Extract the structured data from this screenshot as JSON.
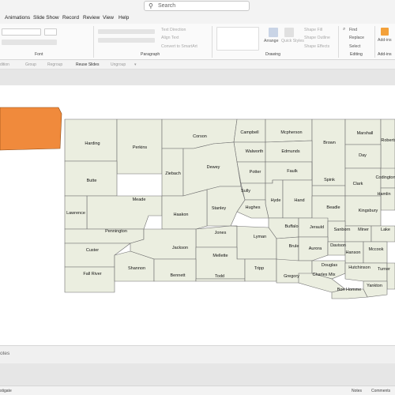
{
  "search": {
    "placeholder": "Search"
  },
  "tabs": [
    "Animations",
    "Slide Show",
    "Record",
    "Review",
    "View",
    "Help"
  ],
  "ribbon": {
    "font_group": "Font",
    "paragraph_group": "Paragraph",
    "drawing_group": "Drawing",
    "editing_group": "Editing",
    "addins_group": "Add-ins",
    "text_direction": "Text Direction",
    "align_text": "Align Text",
    "convert_smartart": "Convert to SmartArt",
    "arrange": "Arrange",
    "quick_styles": "Quick Styles",
    "shape_fill": "Shape Fill",
    "shape_outline": "Shape Outline",
    "shape_effects": "Shape Effects",
    "find": "Find",
    "replace": "Replace",
    "select": "Select",
    "addins_button": "Add-ins"
  },
  "toolbar": {
    "edit": "dition",
    "group": "Group",
    "regroup": "Regroup",
    "reuse_slides": "Reuse Slides",
    "ungroup": "Ungroup",
    "more": "▾"
  },
  "map": {
    "counties": [
      "Harding",
      "Perkins",
      "Corson",
      "Campbell",
      "Mcpherson",
      "Brown",
      "Marshall",
      "Roberts",
      "Walworth",
      "Edmunds",
      "Day",
      "Butte",
      "Ziebach",
      "Dewey",
      "Potter",
      "Faulk",
      "Spink",
      "Clark",
      "Codington",
      "Hamlin",
      "Meade",
      "Sully",
      "Hyde",
      "Hand",
      "Hughes",
      "Stanley",
      "Beadle",
      "Kingsbury",
      "Lawrence",
      "Haakon",
      "Buffalo",
      "Jerauld",
      "Sanborn",
      "Miner",
      "Lake",
      "Pennington",
      "Jones",
      "Lyman",
      "Custer",
      "Jackson",
      "Brule",
      "Aurora",
      "Davison",
      "Hanson",
      "Mccook",
      "Mellette",
      "Fall River",
      "Shannon",
      "Bennett",
      "Todd",
      "Tripp",
      "Gregory",
      "Douglas",
      "Charles Mix",
      "Hutchinson",
      "Turner",
      "Yankton",
      "Bon Homme"
    ]
  },
  "notes": {
    "label": "otes"
  },
  "status": {
    "left": "stigate",
    "notes": "Notes",
    "comments": "Comments"
  },
  "colors": {
    "county_fill": "#ebeee0",
    "county_border": "#6e6e6e",
    "highlight_shape": "#f08a3c"
  }
}
